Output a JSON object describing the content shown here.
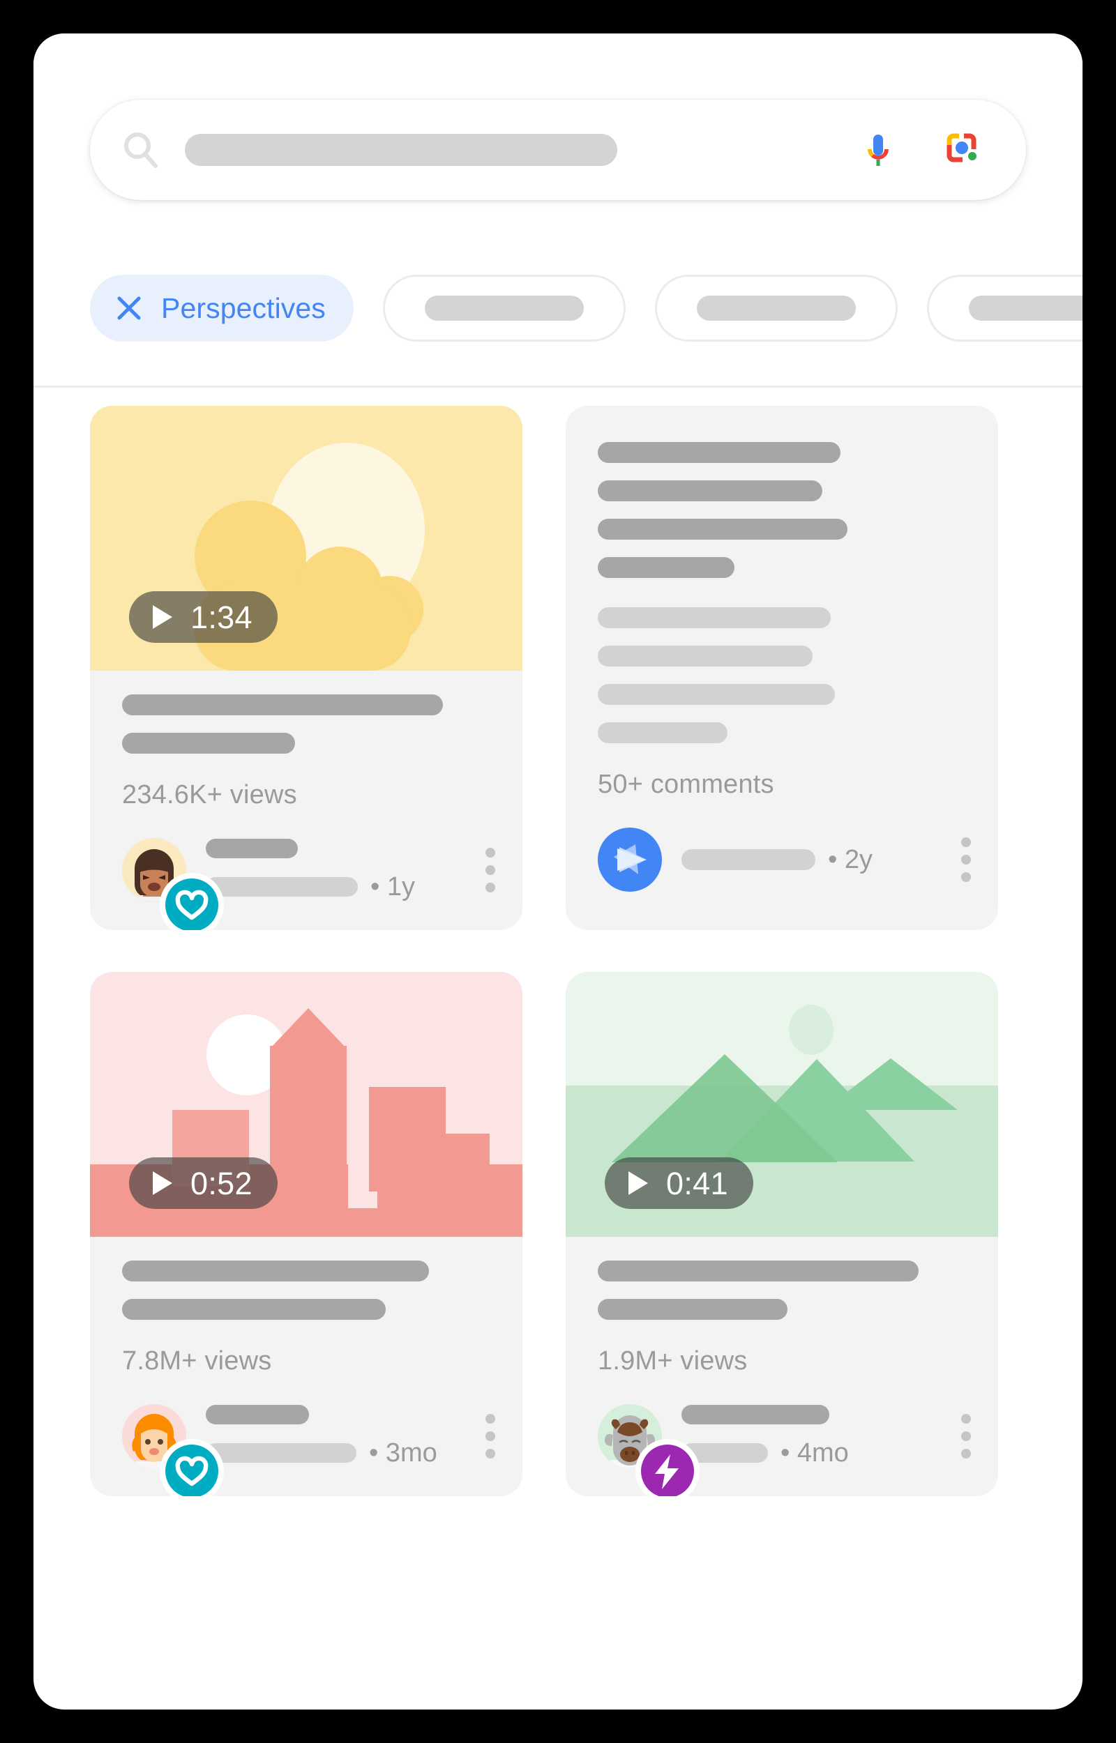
{
  "search": {
    "icon": "search-icon",
    "placeholder_value": "",
    "mic_icon": "microphone-icon",
    "lens_icon": "google-lens-icon"
  },
  "filters": {
    "active_chip": {
      "label": "Perspectives",
      "icon": "close-x-icon",
      "color": "#4285f4",
      "background": "#e8f0fe"
    },
    "placeholder_chips": [
      "",
      "",
      ""
    ]
  },
  "cards": [
    {
      "type": "video",
      "thumbnail": "sun-and-cloud-illustration",
      "duration": "1:34",
      "stats": "234.6K+ views",
      "avatar": "woman-avatar",
      "avatar_badge": "heart-verified-badge",
      "badge_color": "#00acc1",
      "age": "• 1y",
      "menu_icon": "kebab-menu-icon"
    },
    {
      "type": "text",
      "stats": "50+ comments",
      "avatar": "play-arrow-circle",
      "badge_color": "#4285f4",
      "age": "• 2y",
      "menu_icon": "kebab-menu-icon"
    },
    {
      "type": "video",
      "thumbnail": "city-skyline-illustration",
      "duration": "0:52",
      "stats": "7.8M+ views",
      "avatar": "orange-hair-woman-avatar",
      "avatar_badge": "heart-verified-badge",
      "badge_color": "#00acc1",
      "age": "• 3mo",
      "menu_icon": "kebab-menu-icon"
    },
    {
      "type": "video",
      "thumbnail": "green-mountains-illustration",
      "duration": "0:41",
      "stats": "1.9M+ views",
      "avatar": "ox-avatar",
      "avatar_badge": "lightning-bolt-badge",
      "badge_color": "#9c27b0",
      "age": "• 4mo",
      "menu_icon": "kebab-menu-icon"
    }
  ],
  "theme": {
    "accent_blue": "#4285f4",
    "chip_bg": "#e8f0fe",
    "card_bg": "#f3f3f3",
    "thumb_yellow": "#fce8ab",
    "thumb_pink": "#fce4e4",
    "thumb_green": "#e8f5e9",
    "muted_text": "#9a9a9a"
  }
}
